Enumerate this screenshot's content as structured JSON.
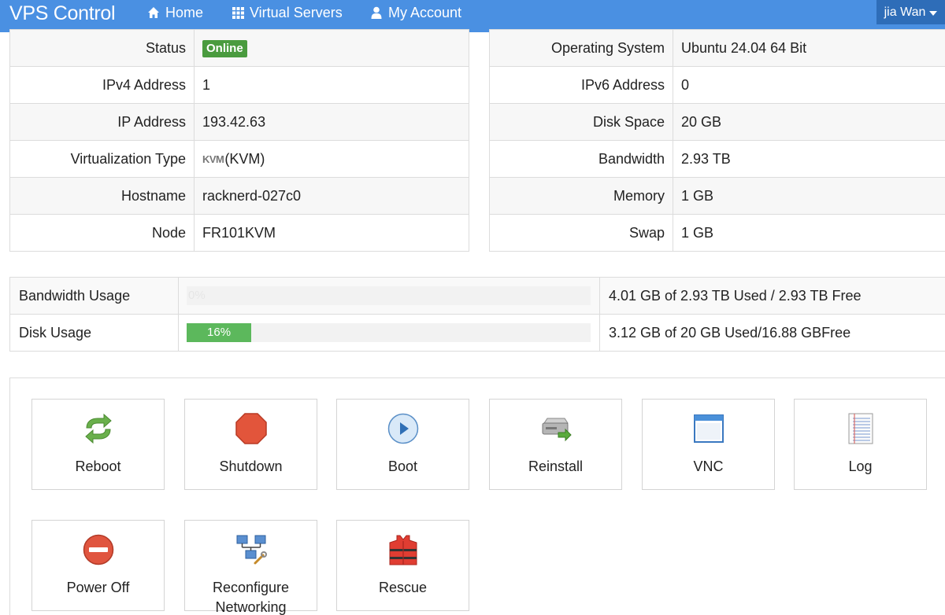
{
  "navbar": {
    "brand": "VPS Control",
    "home": "Home",
    "virtual_servers": "Virtual Servers",
    "my_account": "My Account",
    "user": "jia Wan"
  },
  "info_left": {
    "status_label": "Status",
    "status_value": "Online",
    "ipv4_label": "IPv4 Address",
    "ipv4_value": "1",
    "ip_label": "IP Address",
    "ip_value": "193.42.63",
    "virt_label": "Virtualization Type",
    "virt_logo": "KVM",
    "virt_value": "(KVM)",
    "hostname_label": "Hostname",
    "hostname_value": "racknerd-027c0",
    "node_label": "Node",
    "node_value": "FR101KVM"
  },
  "info_right": {
    "os_label": "Operating System",
    "os_value": "Ubuntu 24.04 64 Bit",
    "ipv6_label": "IPv6 Address",
    "ipv6_value": "0",
    "disk_label": "Disk Space",
    "disk_value": "20 GB",
    "bandwidth_label": "Bandwidth",
    "bandwidth_value": "2.93 TB",
    "memory_label": "Memory",
    "memory_value": "1 GB",
    "swap_label": "Swap",
    "swap_value": "1 GB"
  },
  "usage": {
    "bandwidth": {
      "label": "Bandwidth Usage",
      "percent": 0,
      "percent_text": "0%",
      "detail": "4.01 GB of 2.93 TB Used / 2.93 TB Free"
    },
    "disk": {
      "label": "Disk Usage",
      "percent": 16,
      "percent_text": "16%",
      "detail": "3.12 GB of 20 GB Used/16.88 GBFree"
    }
  },
  "actions": {
    "reboot": "Reboot",
    "shutdown": "Shutdown",
    "boot": "Boot",
    "reinstall": "Reinstall",
    "vnc": "VNC",
    "log": "Log",
    "power_off": "Power Off",
    "reconfigure_line1": "Reconfigure",
    "reconfigure_line2": "Networking",
    "rescue": "Rescue"
  },
  "colors": {
    "navbar": "#4a90e2",
    "user_menu": "#2e6db8",
    "online_badge": "#4a9b3f",
    "progress_fill": "#5cb85c"
  },
  "icons": {
    "home": "home-icon",
    "virtual_servers": "grid-icon",
    "my_account": "user-icon",
    "reboot": "refresh-arrows-icon",
    "shutdown": "stop-sign-icon",
    "boot": "play-circle-icon",
    "reinstall": "drive-arrow-icon",
    "vnc": "window-icon",
    "log": "notepad-icon",
    "power_off": "no-entry-icon",
    "reconfigure": "network-icon",
    "rescue": "life-vest-icon"
  }
}
